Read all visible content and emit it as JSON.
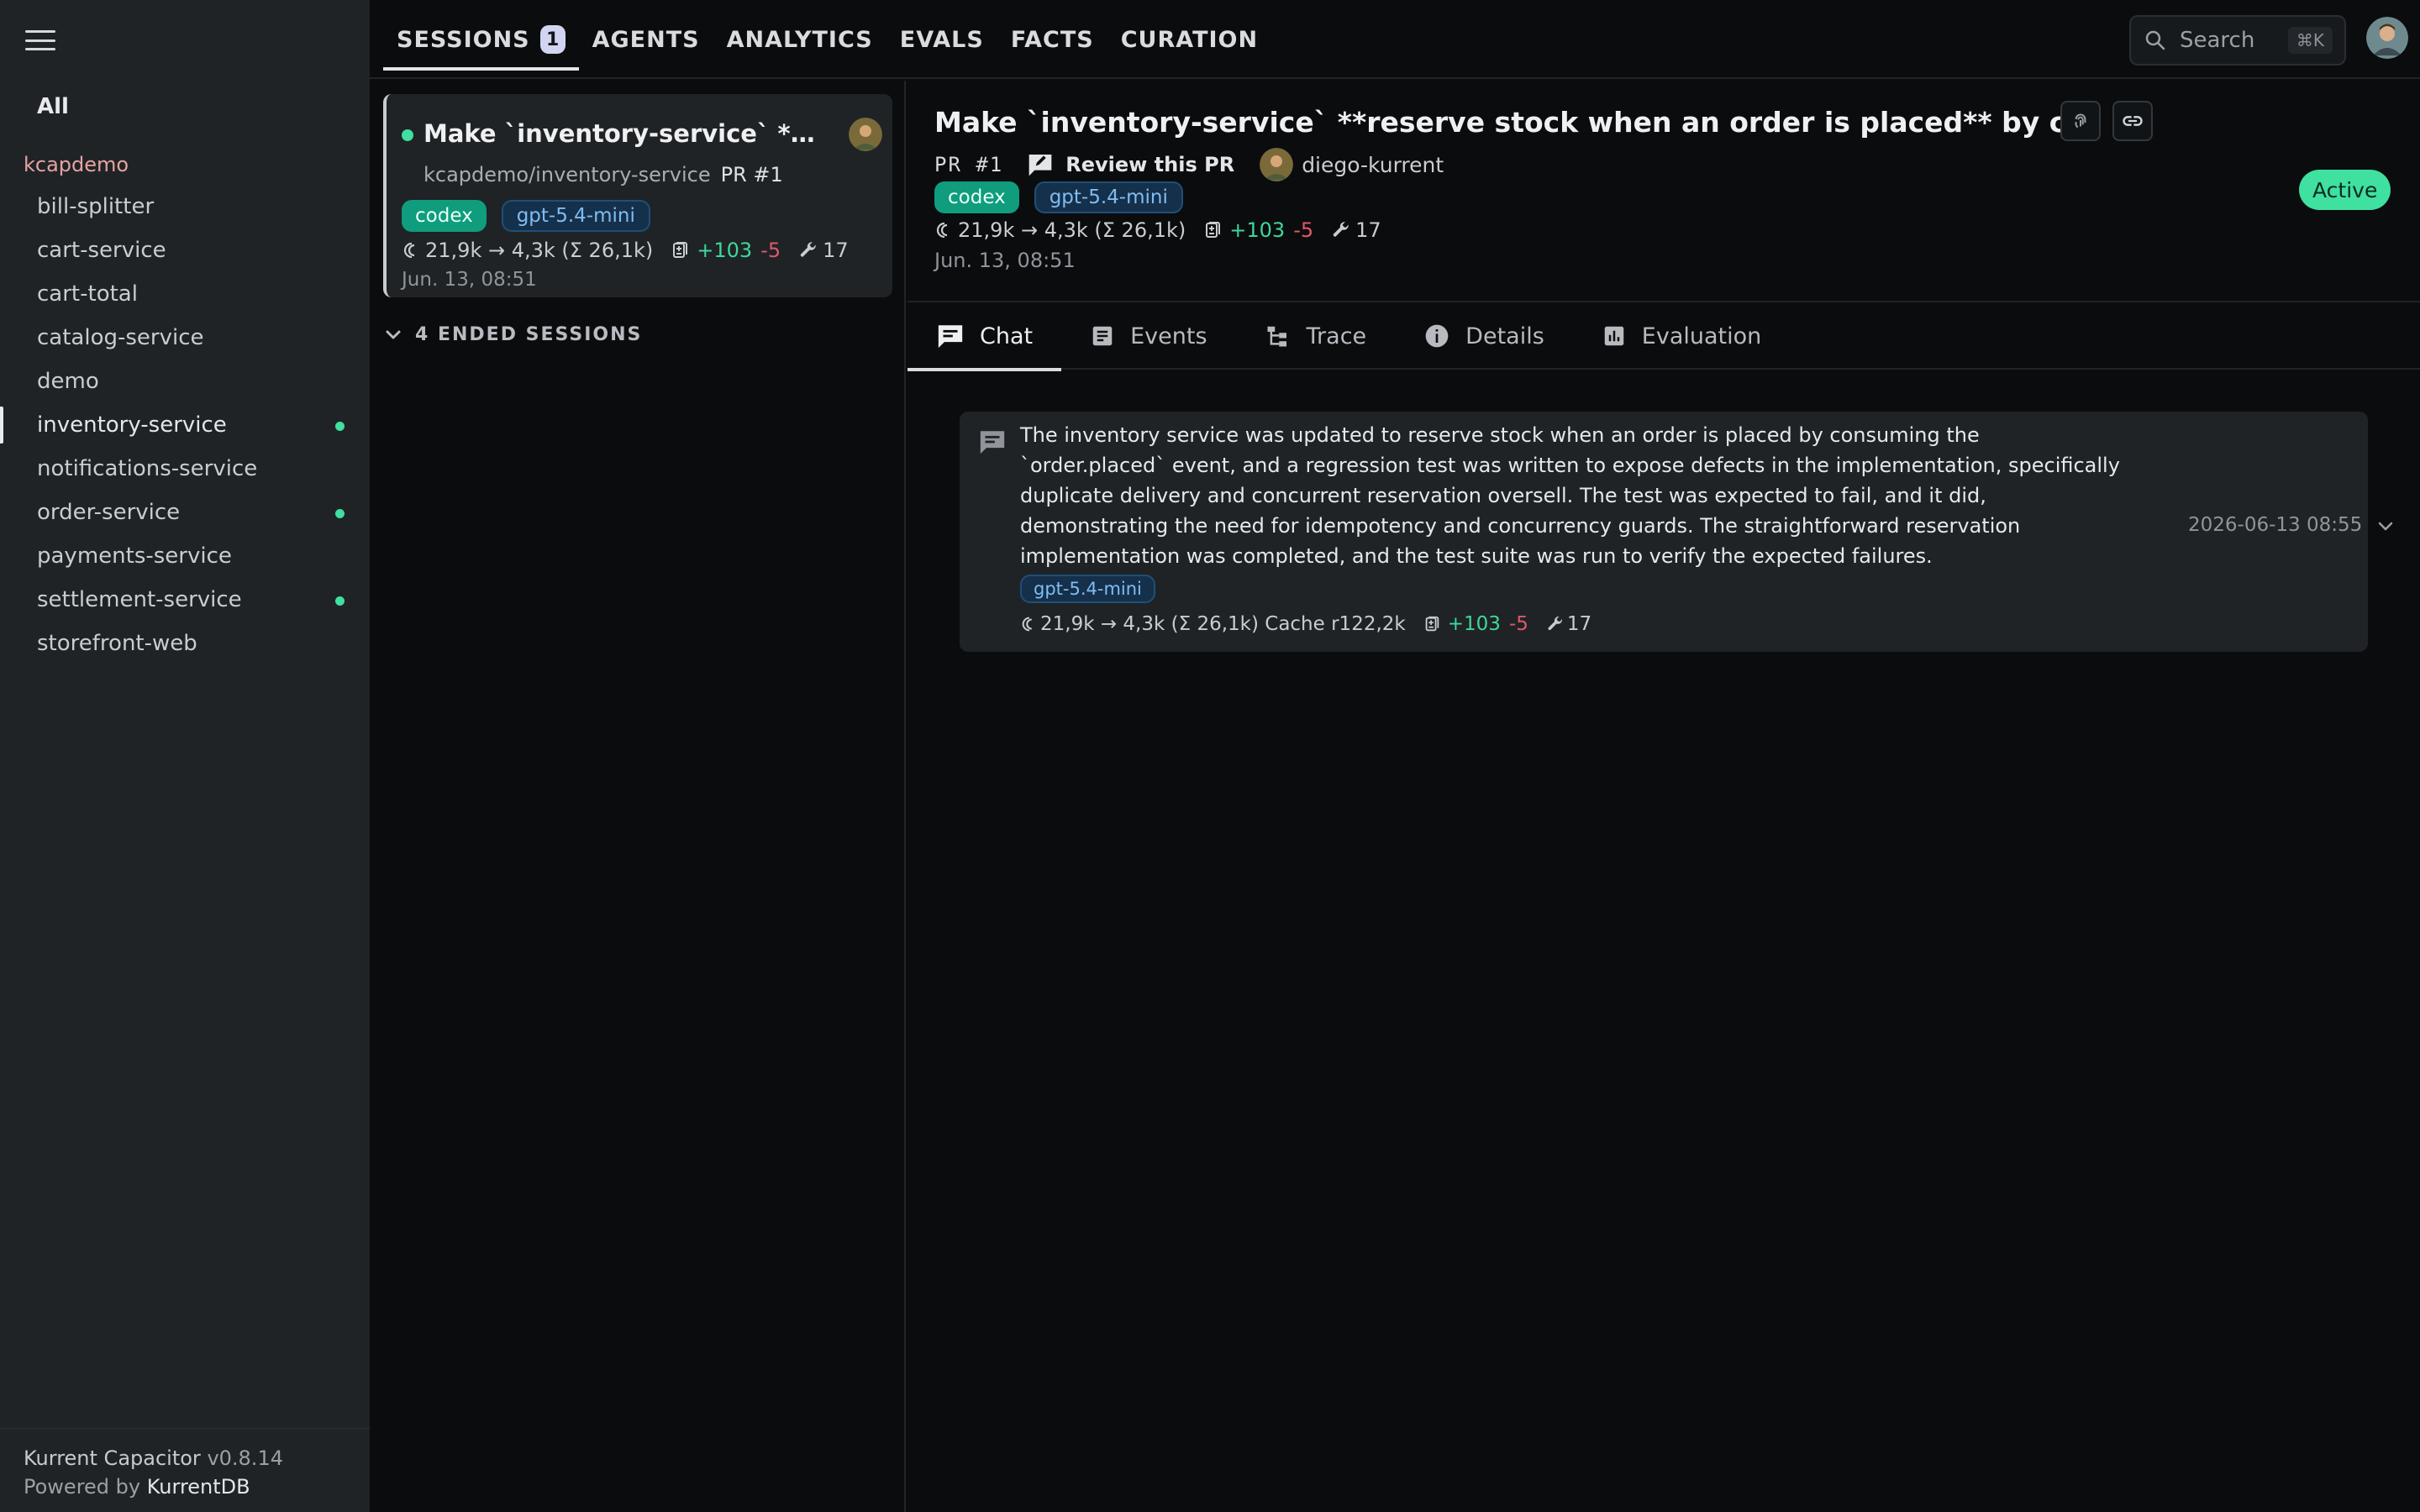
{
  "sidebar": {
    "all_label": "All",
    "org": "kcapdemo",
    "repos": [
      {
        "name": "bill-splitter",
        "active": false,
        "selected": false
      },
      {
        "name": "cart-service",
        "active": false,
        "selected": false
      },
      {
        "name": "cart-total",
        "active": false,
        "selected": false
      },
      {
        "name": "catalog-service",
        "active": false,
        "selected": false
      },
      {
        "name": "demo",
        "active": false,
        "selected": false
      },
      {
        "name": "inventory-service",
        "active": true,
        "selected": true
      },
      {
        "name": "notifications-service",
        "active": false,
        "selected": false
      },
      {
        "name": "order-service",
        "active": true,
        "selected": false
      },
      {
        "name": "payments-service",
        "active": false,
        "selected": false
      },
      {
        "name": "settlement-service",
        "active": true,
        "selected": false
      },
      {
        "name": "storefront-web",
        "active": false,
        "selected": false
      }
    ],
    "footer": {
      "app_name": "Kurrent Capacitor",
      "version": "v0.8.14",
      "powered_by": "Powered by",
      "powered_link": "KurrentDB"
    }
  },
  "topnav": {
    "items": [
      "SESSIONS",
      "AGENTS",
      "ANALYTICS",
      "EVALS",
      "FACTS",
      "CURATION"
    ],
    "sessions_count": "1",
    "search_placeholder": "Search",
    "search_shortcut": "⌘K"
  },
  "session_list": {
    "card": {
      "title": "Make `inventory-service` **reserve stock when an order is placed** by consuming...",
      "repo": "kcapdemo/inventory-service",
      "pr": "PR #1",
      "agent_tag": "codex",
      "model_tag": "gpt-5.4-mini",
      "tokens": "21,9k → 4,3k (Σ 26,1k)",
      "added": "+103",
      "removed": "-5",
      "tools": "17",
      "date": "Jun. 13, 08:51"
    },
    "ended_label": "4 ENDED SESSIONS"
  },
  "detail": {
    "title": "Make `inventory-service` **reserve stock when an order is placed** by consuming the `order.placed` event",
    "pr_label": "PR #1",
    "review_label": "Review this PR",
    "user": "diego-kurrent",
    "agent_tag": "codex",
    "model_tag": "gpt-5.4-mini",
    "tokens": "21,9k → 4,3k (Σ 26,1k)",
    "added": "+103",
    "removed": "-5",
    "tools": "17",
    "date": "Jun. 13, 08:51",
    "status": "Active"
  },
  "tabs": [
    "Chat",
    "Events",
    "Trace",
    "Details",
    "Evaluation"
  ],
  "message": {
    "text": "The inventory service was updated to reserve stock when an order is placed by consuming the `order.placed` event, and a regression test was written to expose defects in the implementation, specifically duplicate delivery and concurrent reservation oversell. The test was expected to fail, and it did, demonstrating the need for idempotency and concurrency guards. The straightforward reservation implementation was completed, and the test suite was run to verify the expected failures.",
    "model_tag": "gpt-5.4-mini",
    "tokens": "21,9k → 4,3k (Σ 26,1k) Cache r122,2k",
    "added": "+103",
    "removed": "-5",
    "tools": "17",
    "timestamp": "2026-06-13 08:55"
  },
  "colors": {
    "accent_green": "#3fe0a0",
    "codex_tag": "#0f9d7d",
    "model_tag_text": "#7fbdf2",
    "removed_red": "#e0576a",
    "org_label": "#e7a2a2"
  }
}
